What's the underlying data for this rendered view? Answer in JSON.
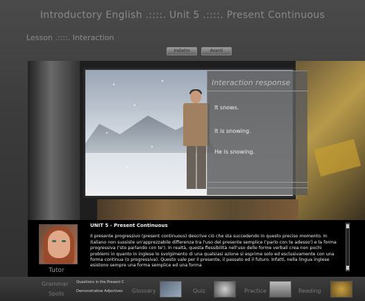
{
  "header": {
    "title": "Introductory English .::::. Unit 5 .::::. Present Continuous",
    "lesson": "Lesson .::::. Interaction"
  },
  "nav": {
    "buttons": [
      "Indietro",
      "Avanti"
    ]
  },
  "response_panel": {
    "title": "Interaction response",
    "lines": [
      "It snows.",
      "It is snowing.",
      "He is snowing."
    ]
  },
  "lesson_text": {
    "heading": "UNIT 5 - Present Continuous",
    "body": "Il presente progressivo (present continuous) descrive ciò che sta succedendo in questo preciso momento. In italiano non sussiste un'apprezzabile differenza tra l'uso del presente semplice ('parlo con te adesso') e la forma progressiva ('sto parlando con te'). In realtà, questa flessibilità nell'uso delle forme verbali crea non pochi problemi in quanto in inglese lo svolgimento di una qualsiasi azione si esprime solo ed esclusivamente con una forma continua (o progressiva). Questo vale per il presente, il passato ed il futuro. Infatti, nella lingua inglese esistono sempre una forma semplice ed una forma"
  },
  "tutor": {
    "label": "Tutor"
  },
  "footer": {
    "grammar": "Grammar",
    "spots": "Spots",
    "links": [
      "Questions in the Present C",
      "Demonstrative Adjectives"
    ],
    "glossary": "Glossary",
    "quiz": "Quiz",
    "practice": "Practice",
    "reading": "Reading"
  },
  "icons": [
    "glossary-icon",
    "quiz-icon",
    "practice-icon",
    "reading-icon",
    "scroll-up-icon",
    "scroll-down-icon"
  ]
}
